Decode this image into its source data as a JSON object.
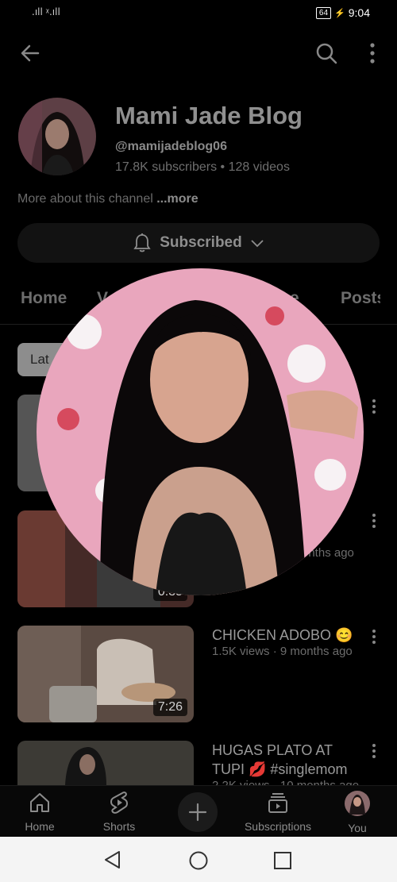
{
  "status_bar": {
    "signal": ".ıll ᵡ.ıll",
    "battery": "64",
    "time": "9:04"
  },
  "header": {
    "back_icon": "arrow-left-icon",
    "search_icon": "search-icon",
    "more_icon": "more-vertical-icon"
  },
  "channel": {
    "name": "Mami Jade Blog",
    "handle": "@mamijadeblog06",
    "subscribers": "17.8K subscribers",
    "separator": " • ",
    "videos": "128 videos",
    "about_text": "More about this channel ",
    "about_more": "...more"
  },
  "subscribe_button": {
    "label": "Subscribed",
    "bell_icon": "bell-icon",
    "chevron_icon": "chevron-down-icon"
  },
  "tabs": [
    {
      "label": "Home"
    },
    {
      "label": "V"
    },
    {
      "label": "e"
    },
    {
      "label": "Posts"
    }
  ],
  "filter_chip": {
    "label": "Lat"
  },
  "videos": [
    {
      "title": "",
      "meta": "",
      "duration": ""
    },
    {
      "title": "",
      "meta": "onths ago",
      "duration": "0:35"
    },
    {
      "title": "CHICKEN ADOBO 😊",
      "meta": "1.5K views · 9 months ago",
      "duration": "7:26"
    },
    {
      "title": "HUGAS PLATO AT TUPI 💋 #singlemom",
      "meta": "2.2K views · 10 months ago",
      "duration": ""
    }
  ],
  "bottom_nav": [
    {
      "label": "Home",
      "icon": "home-icon"
    },
    {
      "label": "Shorts",
      "icon": "shorts-icon"
    },
    {
      "label": "",
      "icon": "plus-icon"
    },
    {
      "label": "Subscriptions",
      "icon": "subscriptions-icon"
    },
    {
      "label": "You",
      "icon": "avatar-icon"
    }
  ],
  "system_nav": {
    "back": "triangle-back-icon",
    "home": "circle-home-icon",
    "recents": "square-recents-icon"
  },
  "colors": {
    "background": "#000000",
    "overlay_photo_pink": "#e9a6bd",
    "chip": "#8d8d8d"
  }
}
